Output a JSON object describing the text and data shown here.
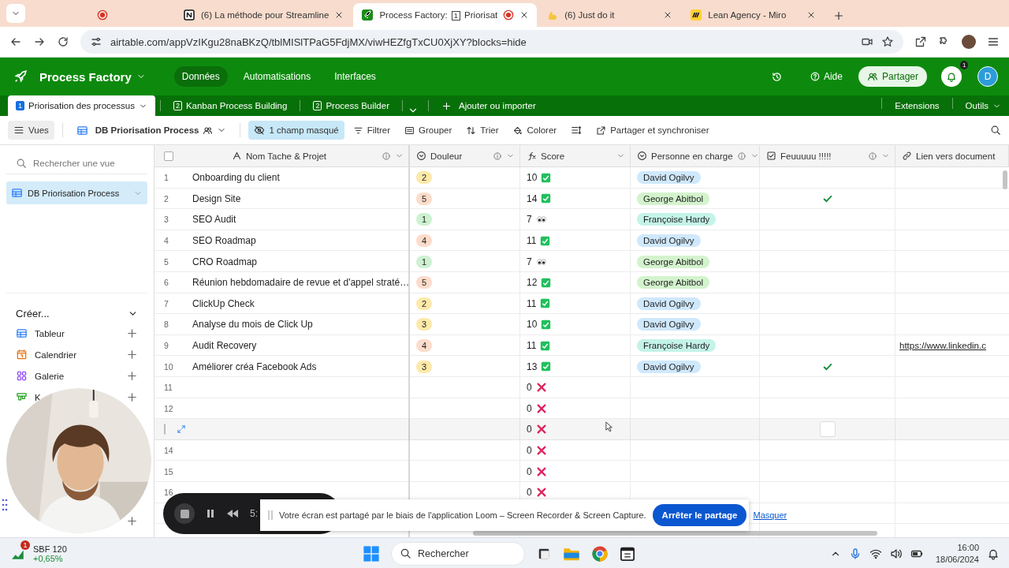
{
  "browser": {
    "tabs": [
      {
        "kind": "recording",
        "selected": false
      },
      {
        "kind": "page",
        "title": "(6) La méthode pour Streamline",
        "selected": false,
        "recording": false
      },
      {
        "kind": "page",
        "title": "Process Factory:",
        "badge": "1",
        "title_end": "Priorisat",
        "selected": true,
        "recording": true
      },
      {
        "kind": "page",
        "title": "(6) Just do it",
        "selected": false,
        "recording": false
      },
      {
        "kind": "page",
        "title": "Lean Agency - Miro",
        "selected": false,
        "recording": false
      }
    ],
    "url": "airtable.com/appVzIKgu28naBKzQ/tblMISlTPaG5FdjMX/viwHEZfgTxCU0XjXY?blocks=hide"
  },
  "base": {
    "name": "Process Factory",
    "nav": [
      {
        "label": "Données",
        "selected": true
      },
      {
        "label": "Automatisations",
        "selected": false
      },
      {
        "label": "Interfaces",
        "selected": false
      }
    ],
    "help": "Aide",
    "share": "Partager",
    "notifications": "1",
    "avatar": "D"
  },
  "tables": {
    "tabs": [
      {
        "badge": "1",
        "label": "Priorisation des processus",
        "selected": true
      },
      {
        "badge": "2",
        "label": "Kanban Process Building",
        "selected": false
      },
      {
        "badge": "2",
        "label": "Process Builder",
        "selected": false
      }
    ],
    "add": "Ajouter ou importer",
    "extensions": "Extensions",
    "tools": "Outils"
  },
  "toolbar": {
    "views": "Vues",
    "view_name": "DB Priorisation Process",
    "hidden_fields": "1 champ masqué",
    "actions": [
      "Filtrer",
      "Grouper",
      "Trier",
      "Colorer"
    ],
    "sync": "Partager et synchroniser"
  },
  "sidebar": {
    "search_placeholder": "Rechercher une vue",
    "views": [
      {
        "label": "DB Priorisation Process",
        "selected": true
      }
    ],
    "create_title": "Créer...",
    "create_items": [
      {
        "label": "Tableur",
        "kind": "grid"
      },
      {
        "label": "Calendrier",
        "kind": "calendar"
      },
      {
        "label": "Galerie",
        "kind": "gallery"
      },
      {
        "label": "K",
        "kind": "kanban"
      }
    ]
  },
  "table": {
    "all_selected": false,
    "columns": [
      {
        "label": "Nom Tache & Projet",
        "kind": "text"
      },
      {
        "label": "Douleur",
        "kind": "select"
      },
      {
        "label": "Score",
        "kind": "formula"
      },
      {
        "label": "Personne en charge",
        "kind": "select"
      },
      {
        "label": "Feuuuuu !!!!!",
        "kind": "checkbox"
      },
      {
        "label": "Lien vers document",
        "kind": "link"
      }
    ],
    "rows": [
      {
        "number": "1",
        "hovered": false,
        "name": "Onboarding du client",
        "pain": {
          "value": "2",
          "color": "#fde9a9"
        },
        "score": {
          "value": "10",
          "kind": "check"
        },
        "owner": {
          "name": "David Ogilvy",
          "color": "#cfe8fc"
        },
        "fire": {
          "checked": false
        }
      },
      {
        "number": "2",
        "hovered": false,
        "name": "Design Site",
        "pain": {
          "value": "5",
          "color": "#fcdccb"
        },
        "score": {
          "value": "14",
          "kind": "check"
        },
        "owner": {
          "name": "George Abitbol",
          "color": "#d3f3cd"
        },
        "fire": {
          "checked": true
        }
      },
      {
        "number": "3",
        "hovered": false,
        "name": "SEO Audit",
        "pain": {
          "value": "1",
          "color": "#cdf1d1"
        },
        "score": {
          "value": "7",
          "kind": "eyes"
        },
        "owner": {
          "name": "Françoise Hardy",
          "color": "#c4f3e8"
        },
        "fire": {
          "checked": false
        }
      },
      {
        "number": "4",
        "hovered": false,
        "name": "SEO Roadmap",
        "pain": {
          "value": "4",
          "color": "#fcdccb"
        },
        "score": {
          "value": "11",
          "kind": "check"
        },
        "owner": {
          "name": "David Ogilvy",
          "color": "#cfe8fc"
        },
        "fire": {
          "checked": false
        }
      },
      {
        "number": "5",
        "hovered": false,
        "name": "CRO Roadmap",
        "pain": {
          "value": "1",
          "color": "#cdf1d1"
        },
        "score": {
          "value": "7",
          "kind": "eyes"
        },
        "owner": {
          "name": "George Abitbol",
          "color": "#d3f3cd"
        },
        "fire": {
          "checked": false
        }
      },
      {
        "number": "6",
        "hovered": false,
        "name": "Réunion hebdomadaire de revue et d'appel straté…",
        "pain": {
          "value": "5",
          "color": "#fcdccb"
        },
        "score": {
          "value": "12",
          "kind": "check"
        },
        "owner": {
          "name": "George Abitbol",
          "color": "#d3f3cd"
        },
        "fire": {
          "checked": false
        }
      },
      {
        "number": "7",
        "hovered": false,
        "name": "ClickUp Check",
        "pain": {
          "value": "2",
          "color": "#fde9a9"
        },
        "score": {
          "value": "11",
          "kind": "check"
        },
        "owner": {
          "name": "David Ogilvy",
          "color": "#cfe8fc"
        },
        "fire": {
          "checked": false
        }
      },
      {
        "number": "8",
        "hovered": false,
        "name": "Analyse du mois de Click Up",
        "pain": {
          "value": "3",
          "color": "#fde9a9"
        },
        "score": {
          "value": "10",
          "kind": "check"
        },
        "owner": {
          "name": "David Ogilvy",
          "color": "#cfe8fc"
        },
        "fire": {
          "checked": false
        }
      },
      {
        "number": "9",
        "hovered": false,
        "name": "Audit Recovery",
        "pain": {
          "value": "4",
          "color": "#fcdccb"
        },
        "score": {
          "value": "11",
          "kind": "check"
        },
        "owner": {
          "name": "Françoise Hardy",
          "color": "#c4f3e8"
        },
        "fire": {
          "checked": false
        },
        "link": "https://www.linkedin.c"
      },
      {
        "number": "10",
        "hovered": false,
        "name": "Améliorer créa Facebook Ads",
        "pain": {
          "value": "3",
          "color": "#fde9a9"
        },
        "score": {
          "value": "13",
          "kind": "check"
        },
        "owner": {
          "name": "David Ogilvy",
          "color": "#cfe8fc"
        },
        "fire": {
          "checked": true
        }
      },
      {
        "number": "11",
        "hovered": false,
        "score": {
          "value": "0",
          "kind": "cross"
        },
        "fire": {
          "checked": false
        }
      },
      {
        "number": "12",
        "hovered": false,
        "score": {
          "value": "0",
          "kind": "cross"
        },
        "fire": {
          "checked": false
        }
      },
      {
        "hovered": true,
        "score": {
          "value": "0",
          "kind": "cross"
        },
        "fire": {
          "checked": false
        }
      },
      {
        "number": "14",
        "hovered": false,
        "score": {
          "value": "0",
          "kind": "cross"
        },
        "fire": {
          "checked": false
        }
      },
      {
        "number": "15",
        "hovered": false,
        "score": {
          "value": "0",
          "kind": "cross"
        },
        "fire": {
          "checked": false
        }
      },
      {
        "number": "16",
        "hovered": false,
        "score": {
          "value": "0",
          "kind": "cross"
        },
        "fire": {
          "checked": false
        }
      }
    ]
  },
  "loom": {
    "time": "5:"
  },
  "share_notice": {
    "text": "Votre écran est partagé par le biais de l'application Loom – Screen Recorder & Screen Capture.",
    "stop": "Arrêter le partage",
    "hide": "Masquer"
  },
  "taskbar": {
    "stock": {
      "badge": "1",
      "name": "SBF 120",
      "change": "+0,65%"
    },
    "search": "Rechercher",
    "time": "16:00",
    "date": "18/06/2024"
  }
}
